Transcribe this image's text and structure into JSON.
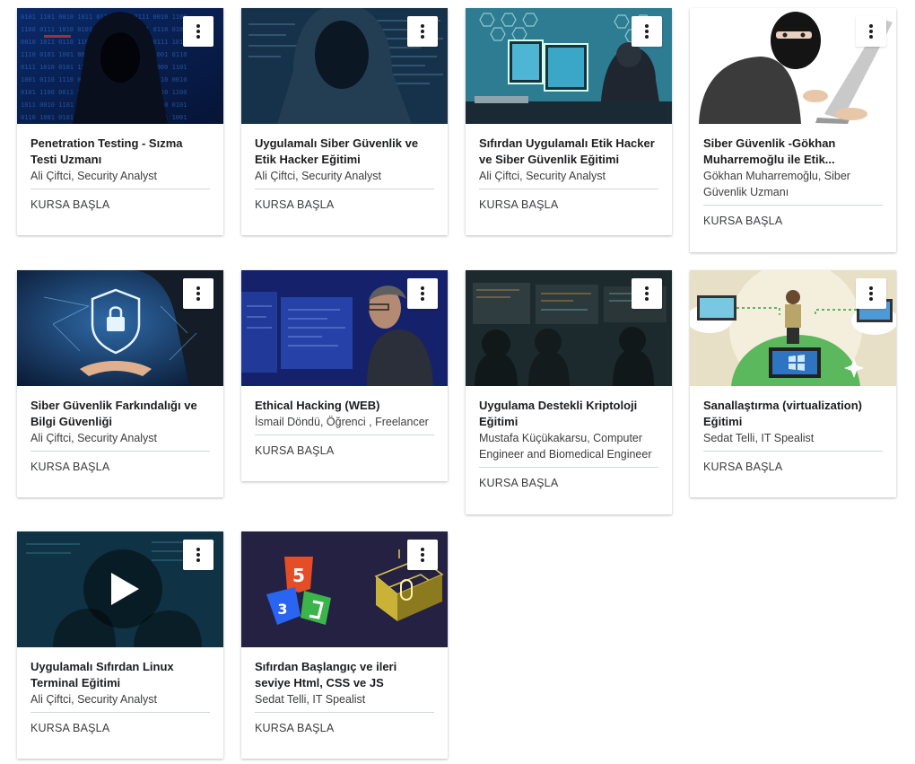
{
  "action_label": "KURSA BAŞLA",
  "courses": [
    {
      "title": "Penetration Testing - Sızma Testi Uzmanı",
      "instructor": "Ali Çiftci, Security Analyst",
      "thumbnail": "hooded-hacker-binary-icon"
    },
    {
      "title": "Uygulamalı Siber Güvenlik ve Etik Hacker Eğitimi",
      "instructor": "Ali Çiftci, Security Analyst",
      "thumbnail": "hooded-hacker-code-icon"
    },
    {
      "title": "Sıfırdan Uygulamalı Etik Hacker ve Siber Güvenlik Eğitimi",
      "instructor": "Ali Çiftci, Security Analyst",
      "thumbnail": "hacker-monitors-icon"
    },
    {
      "title": "Siber Güvenlik -Gökhan Muharremoğlu ile Etik...",
      "instructor": "Gökhan Muharremoğlu, Siber Güvenlik Uzmanı",
      "thumbnail": "masked-man-laptop-icon"
    },
    {
      "title": "Siber Güvenlik Farkındalığı ve Bilgi Güvenliği",
      "instructor": "Ali Çiftci, Security Analyst",
      "thumbnail": "shield-lock-hand-icon"
    },
    {
      "title": "Ethical Hacking (WEB)",
      "instructor": "İsmail Döndü, Öğrenci , Freelancer",
      "thumbnail": "man-at-screens-icon"
    },
    {
      "title": "Uygulama Destekli Kriptoloji Eğitimi",
      "instructor": "Mustafa Küçükakarsu, Computer Engineer and Biomedical Engineer",
      "thumbnail": "control-room-icon"
    },
    {
      "title": "Sanallaştırma (virtualization) Eğitimi",
      "instructor": "Sedat Telli, IT Spealist",
      "thumbnail": "virtualization-cloud-icon"
    },
    {
      "title": "Uygulamalı Sıfırdan Linux Terminal Eğitimi",
      "instructor": "Ali Çiftci, Security Analyst",
      "thumbnail": "video-play-icon"
    },
    {
      "title": "Sıfırdan Başlangıç ve ileri seviye Html, CSS ve JS",
      "instructor": "Sedat Telli, IT Spealist",
      "thumbnail": "html-css-js-logos-icon"
    }
  ]
}
